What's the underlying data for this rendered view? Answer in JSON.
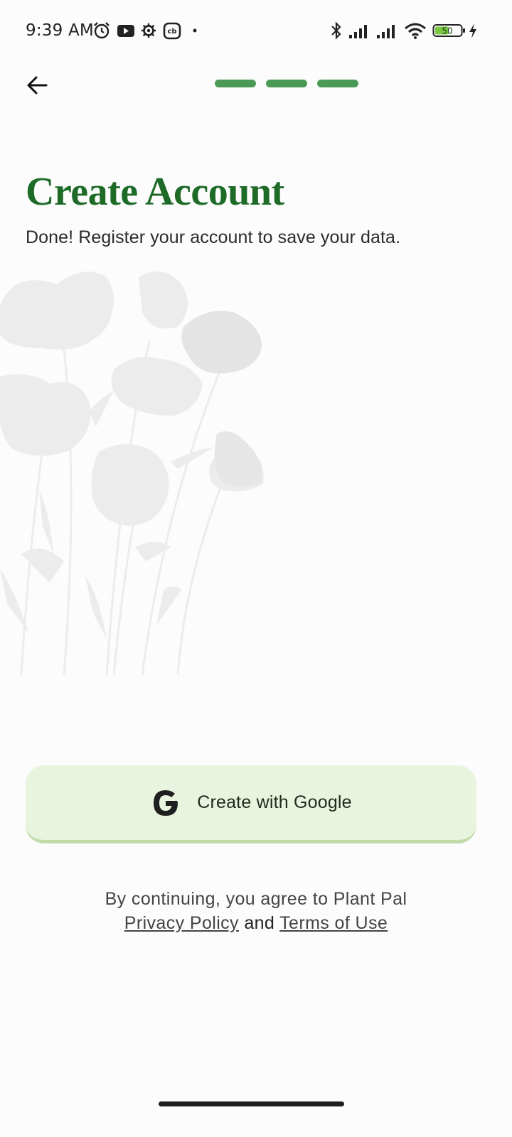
{
  "status_bar": {
    "time": "9:39 AM",
    "battery_level": "50",
    "left_icons": [
      "alarm-icon",
      "youtube-icon",
      "settings-gear-icon",
      "cb-app-icon",
      "dot-icon"
    ],
    "right_icons": [
      "bluetooth-icon",
      "signal-icon",
      "signal-icon",
      "wifi-icon",
      "battery-icon",
      "charging-icon"
    ]
  },
  "top_bar": {
    "back_icon": "arrow-left-icon",
    "progress_steps_total": 3,
    "progress_steps_done": 3
  },
  "header": {
    "title": "Create Account",
    "subtitle": "Done! Register your account to save your data."
  },
  "actions": {
    "google_button_label": "Create with Google",
    "google_icon": "google-g-icon"
  },
  "legal": {
    "prefix": "By continuing, you agree to Plant Pal",
    "privacy_label": "Privacy Policy",
    "and": "and",
    "terms_label": "Terms of Use"
  },
  "colors": {
    "accent": "#1e6b28",
    "progress": "#4a9a55",
    "button_bg": "#e9f4df",
    "background": "#fcfcfc"
  }
}
